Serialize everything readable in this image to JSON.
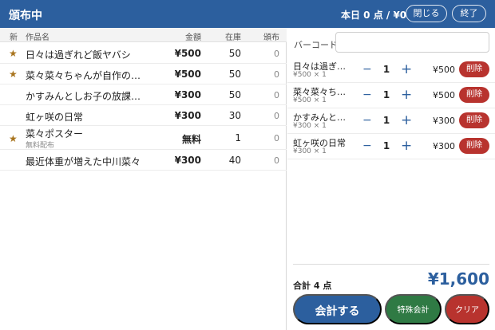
{
  "header": {
    "title": "頒布中",
    "summary": "本日 0 点 / ¥0",
    "close_label": "閉じる",
    "exit_label": "終了"
  },
  "table": {
    "columns": [
      "新",
      "作品名",
      "金額",
      "在庫",
      "頒布"
    ],
    "rows": [
      {
        "star": "★",
        "name": "日々は過ぎれど飯ヤバシ",
        "sub": "",
        "price": "¥500",
        "stock": "50",
        "dist": "0"
      },
      {
        "star": "★",
        "name": "菜々菜々ちゃんが自作の弁当",
        "sub": "",
        "price": "¥500",
        "stock": "50",
        "dist": "0"
      },
      {
        "star": "",
        "name": "かすみんとしお子の放課後デ...",
        "sub": "",
        "price": "¥300",
        "stock": "50",
        "dist": "0"
      },
      {
        "star": "",
        "name": "虹ヶ咲の日常",
        "sub": "",
        "price": "¥300",
        "stock": "30",
        "dist": "0"
      },
      {
        "star": "★",
        "name": "菜々ポスター",
        "sub": "無料配布",
        "price": "無料",
        "stock": "1",
        "dist": "0"
      },
      {
        "star": "",
        "name": "最近体重が増えた中川菜々",
        "sub": "",
        "price": "¥300",
        "stock": "40",
        "dist": "0"
      }
    ]
  },
  "cart": {
    "barcode_label": "バーコード",
    "barcode_value": "",
    "minus_glyph": "−",
    "plus_glyph": "+",
    "delete_label": "削除",
    "items": [
      {
        "name": "日々は過ぎれ...",
        "sub": "¥500 × 1",
        "qty": "1",
        "price": "¥500"
      },
      {
        "name": "菜々菜々ちゃ...",
        "sub": "¥500 × 1",
        "qty": "1",
        "price": "¥500"
      },
      {
        "name": "かすみんとし...",
        "sub": "¥300 × 1",
        "qty": "1",
        "price": "¥300"
      },
      {
        "name": "虹ヶ咲の日常",
        "sub": "¥300 × 1",
        "qty": "1",
        "price": "¥300"
      }
    ],
    "total_label": "合計 4 点",
    "total_value": "¥1,600",
    "pay_label": "会計する",
    "special_label": "特殊会計",
    "clear_label": "クリア"
  },
  "colors": {
    "primary": "#2c5f9e",
    "danger": "#b8332e",
    "success": "#2f7a44",
    "star": "#a8741e"
  }
}
